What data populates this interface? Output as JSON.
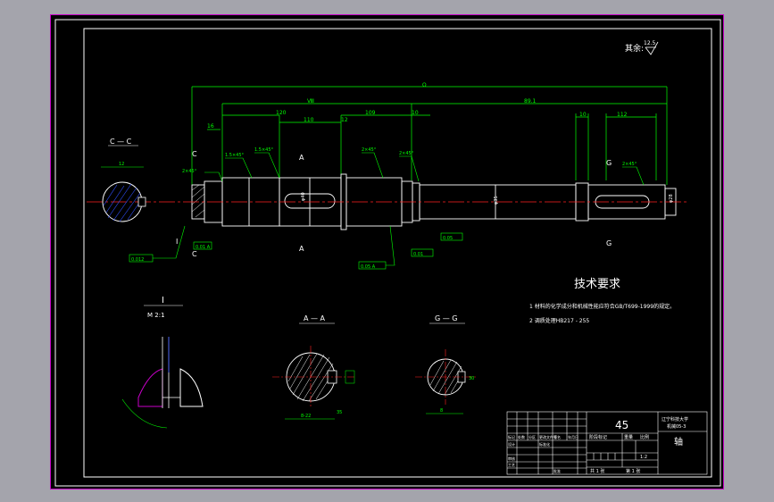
{
  "roughness": {
    "label": "其余:",
    "value": "12.5"
  },
  "dims": {
    "total": "Ω",
    "a": "Ⅷ",
    "b": "89.1",
    "c": "120",
    "d": "110",
    "e": "12",
    "f": "109",
    "g": "10",
    "h": "10",
    "i": "112",
    "j": "16",
    "dia_main": "φ40",
    "dia_end": "φ35",
    "dia_tip": "φ28"
  },
  "chamfers": {
    "c1": "1.5×45°",
    "c2": "2×45°",
    "c3": "1.5×45°",
    "c4": "2×45°",
    "c5": "2×45°",
    "c6": "2×45°"
  },
  "tolerances": {
    "t1": "0.012",
    "t2": "0.05 A",
    "t3": "0.01 A",
    "t4": "0.05",
    "t5": "0.01"
  },
  "section_labels": {
    "cc": "C — C",
    "aa": "A — A",
    "gg": "G — G",
    "detail": "I",
    "detail_scale": "M 2:1",
    "c": "C",
    "a": "A",
    "g": "G",
    "i": "I"
  },
  "section_dims": {
    "cc_w": "12",
    "aa_w": "8-22",
    "aa_d": "35",
    "gg_w": "8",
    "gg_d": "30"
  },
  "tech": {
    "title": "技术要求",
    "items": [
      "1  材料的化学成分和机械性能应符合GB/T699-1999的规定。",
      "2  调质处理HB217 - 255"
    ]
  },
  "title_block": {
    "material": "45",
    "part_name": "轴",
    "school": "辽宁科技大学",
    "dept": "机械05-3",
    "stage_label": "阶段标记",
    "weight_label": "重量",
    "scale_label": "比例",
    "scale": "1:2",
    "sheet_total": "共 1 张",
    "sheet_no": "第 1 张",
    "mark": "标记",
    "count": "处数",
    "zone": "分区",
    "change_no": "更改文件号",
    "sign": "签名",
    "date": "年月日",
    "design": "设计",
    "standard": "标准化",
    "check": "审核",
    "process": "工艺",
    "approve": "批准"
  }
}
